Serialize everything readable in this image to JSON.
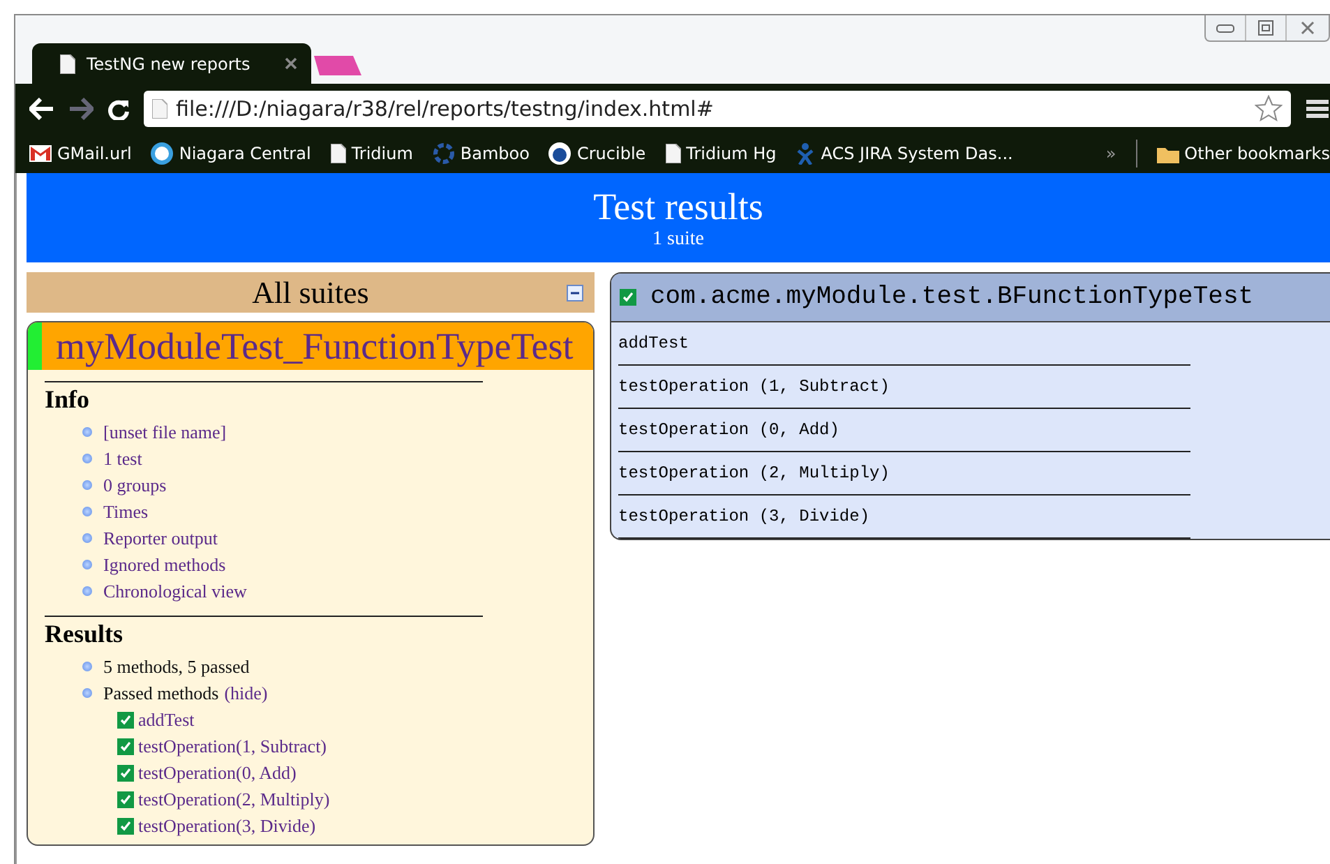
{
  "browser": {
    "tab_title": "TestNG new reports",
    "address": "file:///D:/niagara/r38/rel/reports/testng/index.html#",
    "bookmarks": [
      {
        "kind": "gmail",
        "label": "GMail.url"
      },
      {
        "kind": "niagara",
        "label": "Niagara Central"
      },
      {
        "kind": "page",
        "label": "Tridium"
      },
      {
        "kind": "bamboo",
        "label": "Bamboo"
      },
      {
        "kind": "crucible",
        "label": "Crucible"
      },
      {
        "kind": "page",
        "label": "Tridium Hg"
      },
      {
        "kind": "jira",
        "label": "ACS JIRA System Das..."
      }
    ],
    "more": "»",
    "other_bookmarks": "Other bookmarks"
  },
  "banner": {
    "title": "Test results",
    "subtitle": "1 suite"
  },
  "suites_header": "All suites",
  "suite": {
    "name": "myModuleTest_FunctionTypeTest",
    "passed": true,
    "info_title": "Info",
    "info_links": [
      "[unset file name]",
      "1 test",
      "0 groups",
      "Times",
      "Reporter output",
      "Ignored methods",
      "Chronological view"
    ],
    "results_title": "Results",
    "summary": "5 methods, 5 passed",
    "passed_label": "Passed methods",
    "hide_link": "(hide)",
    "methods": [
      {
        "name": "addTest",
        "passed": true
      },
      {
        "name": "testOperation(1, Subtract)",
        "passed": true
      },
      {
        "name": "testOperation(0, Add)",
        "passed": true
      },
      {
        "name": "testOperation(2, Multiply)",
        "passed": true
      },
      {
        "name": "testOperation(3, Divide)",
        "passed": true
      }
    ]
  },
  "class_panel": {
    "name": "com.acme.myModule.test.BFunctionTypeTest",
    "passed": true,
    "methods": [
      "addTest",
      "testOperation (1, Subtract)",
      "testOperation (0, Add)",
      "testOperation (2, Multiply)",
      "testOperation (3, Divide)"
    ]
  }
}
